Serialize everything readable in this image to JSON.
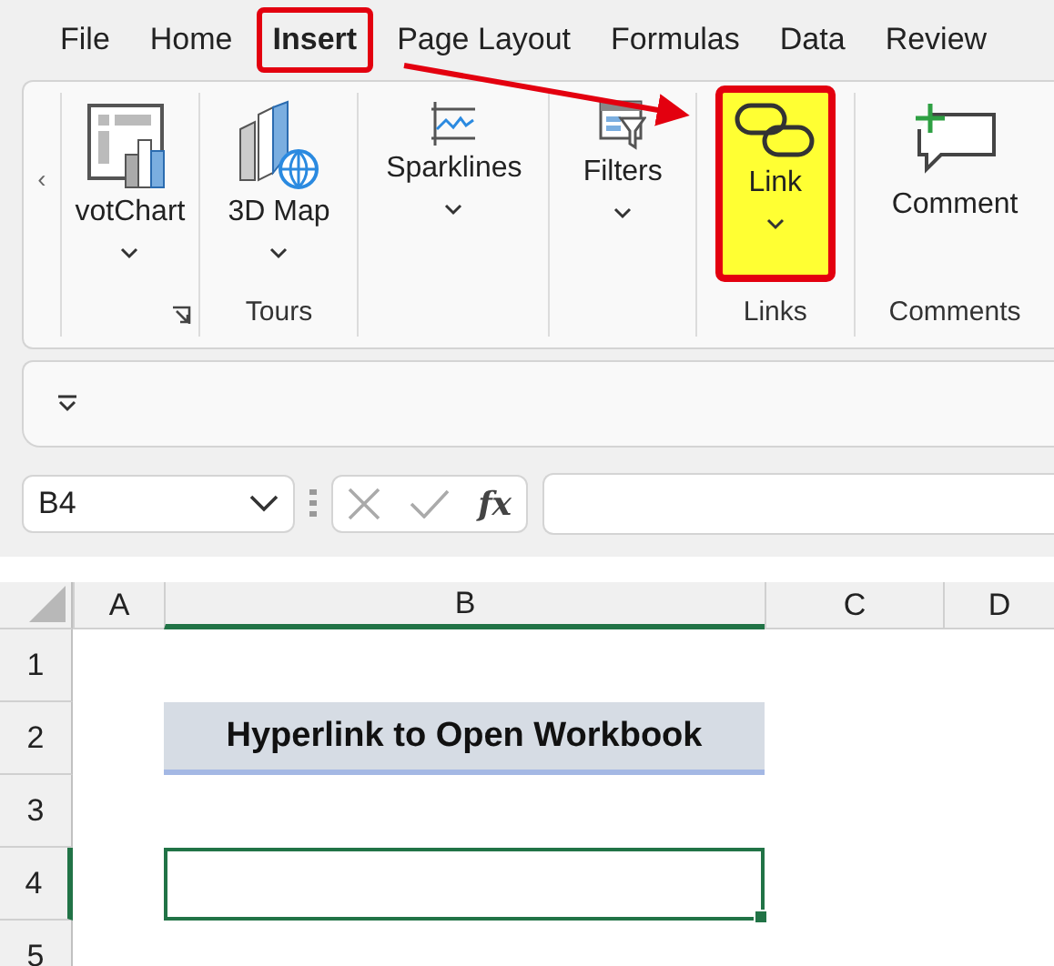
{
  "menu_tabs": [
    {
      "label": "File",
      "selected": false,
      "highlighted": false
    },
    {
      "label": "Home",
      "selected": false,
      "highlighted": false
    },
    {
      "label": "Insert",
      "selected": true,
      "highlighted": true
    },
    {
      "label": "Page Layout",
      "selected": false,
      "highlighted": false
    },
    {
      "label": "Formulas",
      "selected": false,
      "highlighted": false
    },
    {
      "label": "Data",
      "selected": false,
      "highlighted": false
    },
    {
      "label": "Review",
      "selected": false,
      "highlighted": false
    }
  ],
  "ribbon": {
    "scroll_left": "‹",
    "groups": [
      {
        "buttons": [
          {
            "kind": "pivotchart",
            "label": "votChart",
            "dropdown": true,
            "highlighted": false
          }
        ],
        "launcher": true
      },
      {
        "label": "Tours",
        "buttons": [
          {
            "kind": "map3d",
            "label": "3D Map",
            "dropdown": true,
            "highlighted": false
          }
        ]
      },
      {
        "buttons": [
          {
            "kind": "sparklines",
            "label": "Sparklines",
            "dropdown": true,
            "highlighted": false
          }
        ]
      },
      {
        "buttons": [
          {
            "kind": "filters",
            "label": "Filters",
            "dropdown": true,
            "highlighted": false
          }
        ]
      },
      {
        "label": "Links",
        "buttons": [
          {
            "kind": "link",
            "label": "Link",
            "dropdown": true,
            "highlighted": true
          }
        ]
      },
      {
        "label": "Comments",
        "buttons": [
          {
            "kind": "comment",
            "label": "Comment",
            "highlighted": false
          }
        ]
      }
    ]
  },
  "formula_bar": {
    "name_box": "B4",
    "function_symbol": "fx"
  },
  "sheet": {
    "columns": [
      {
        "label": "A",
        "selected": false
      },
      {
        "label": "B",
        "selected": true
      },
      {
        "label": "C",
        "selected": false
      },
      {
        "label": "D",
        "selected": false
      }
    ],
    "rows": [
      {
        "header": "1",
        "selected": false,
        "cells": [
          {
            "kind": "blank"
          },
          {
            "kind": "blank"
          },
          {
            "kind": "blank"
          },
          {
            "kind": "blank"
          }
        ]
      },
      {
        "header": "2",
        "selected": false,
        "cells": [
          {
            "kind": "blank"
          },
          {
            "kind": "title",
            "text": "Hyperlink to Open Workbook"
          },
          {
            "kind": "blank"
          },
          {
            "kind": "blank"
          }
        ]
      },
      {
        "header": "3",
        "selected": false,
        "cells": [
          {
            "kind": "blank"
          },
          {
            "kind": "blank"
          },
          {
            "kind": "blank"
          },
          {
            "kind": "blank"
          }
        ]
      },
      {
        "header": "4",
        "selected": true,
        "cells": [
          {
            "kind": "blank"
          },
          {
            "kind": "active"
          },
          {
            "kind": "blank"
          },
          {
            "kind": "blank"
          }
        ]
      },
      {
        "header": "5",
        "selected": false,
        "cells": [
          {
            "kind": "blank"
          },
          {
            "kind": "blank"
          },
          {
            "kind": "blank"
          },
          {
            "kind": "blank"
          }
        ]
      }
    ]
  }
}
